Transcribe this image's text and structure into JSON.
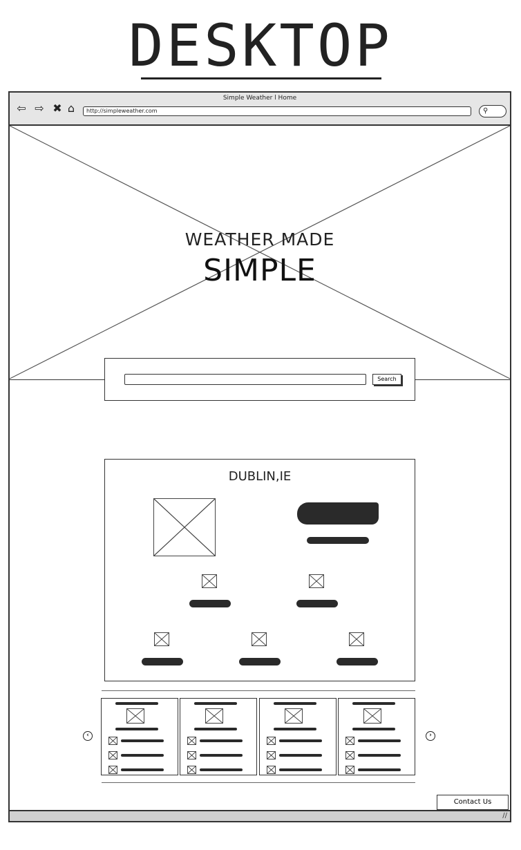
{
  "page_heading": "DESKTOP",
  "browser": {
    "window_title": "Simple Weather l Home",
    "url": "http://simpleweather.com",
    "nav_icons": [
      "back-arrow-icon",
      "forward-arrow-icon",
      "stop-icon",
      "home-icon"
    ],
    "search_icon": "search-icon"
  },
  "hero": {
    "line1": "WEATHER MADE",
    "line2": "SIMPLE",
    "image": "image-placeholder"
  },
  "search": {
    "value": "",
    "button_label": "Search"
  },
  "current_weather": {
    "city": "DUBLIN,IE"
  },
  "forecast": {
    "prev_icon": "chevron-left-icon",
    "next_icon": "chevron-right-icon",
    "card_count_visible": 4
  },
  "footer": {
    "contact_label": "Contact Us"
  },
  "colors": {
    "stroke": "#333333",
    "chrome": "#e6e6e6",
    "scribble": "#2a2a2a"
  }
}
